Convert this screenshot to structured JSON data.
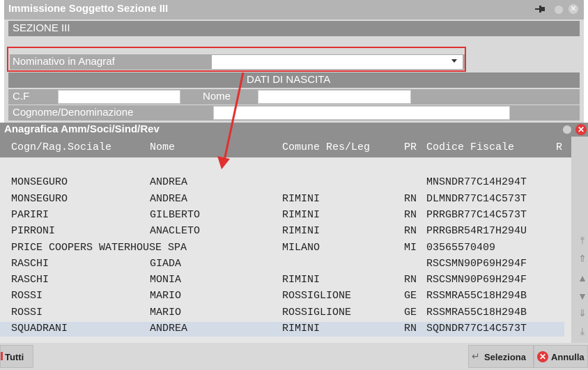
{
  "dialog": {
    "title": "Immissione Soggetto Sezione III",
    "section": "SEZIONE III",
    "nominativo_label": "Nominativo in Anagraf",
    "nominativo_value": "",
    "nascita_header": "DATI DI NASCITA",
    "cf_label": "C.F",
    "cf_value": "",
    "nome_label": "Nome",
    "nome_value": "",
    "cognome_label": "Cognome/Denominazione",
    "cognome_value": "",
    "pin_icon": "pin-icon",
    "highlight_color": "#e03030"
  },
  "list": {
    "title": "Anagrafica Amm/Soci/Sind/Rev",
    "columns": [
      "Cogn/Rag.Sociale",
      "Nome",
      "Comune Res/Leg",
      "PR",
      "Codice Fiscale",
      "R"
    ],
    "rows": [
      {
        "cogn": "",
        "nome": "",
        "comune": "",
        "pr": "",
        "cf": ""
      },
      {
        "cogn": "MONSEGURO",
        "nome": "ANDREA",
        "comune": "",
        "pr": "",
        "cf": "MNSNDR77C14H294T"
      },
      {
        "cogn": "MONSEGURO",
        "nome": "ANDREA",
        "comune": "RIMINI",
        "pr": "RN",
        "cf": "DLMNDR77C14C573T"
      },
      {
        "cogn": "PARIRI",
        "nome": "GILBERTO",
        "comune": "RIMINI",
        "pr": "RN",
        "cf": "PRRGBR77C14C573T"
      },
      {
        "cogn": "PIRRONI",
        "nome": "ANACLETO",
        "comune": "RIMINI",
        "pr": "RN",
        "cf": "PRRGBR54R17H294U"
      },
      {
        "cogn": "PRICE COOPERS WATERHOUSE SPA",
        "nome": "",
        "comune": "MILANO",
        "pr": "MI",
        "cf": "03565570409"
      },
      {
        "cogn": "RASCHI",
        "nome": "GIADA",
        "comune": "",
        "pr": "",
        "cf": "RSCSMN90P69H294F"
      },
      {
        "cogn": "RASCHI",
        "nome": "MONIA",
        "comune": "RIMINI",
        "pr": "RN",
        "cf": "RSCSMN90P69H294F"
      },
      {
        "cogn": "ROSSI",
        "nome": "MARIO",
        "comune": "ROSSIGLIONE",
        "pr": "GE",
        "cf": "RSSMRA55C18H294B"
      },
      {
        "cogn": "ROSSI",
        "nome": "MARIO",
        "comune": "ROSSIGLIONE",
        "pr": "GE",
        "cf": "RSSMRA55C18H294B"
      },
      {
        "cogn": "SQUADRANI",
        "nome": "ANDREA",
        "comune": "RIMINI",
        "pr": "RN",
        "cf": "SQDNDR77C14C573T",
        "selected": true
      }
    ]
  },
  "footer": {
    "tutti_label": "Tutti",
    "seleziona_label": "Seleziona",
    "annulla_label": "Annulla"
  }
}
